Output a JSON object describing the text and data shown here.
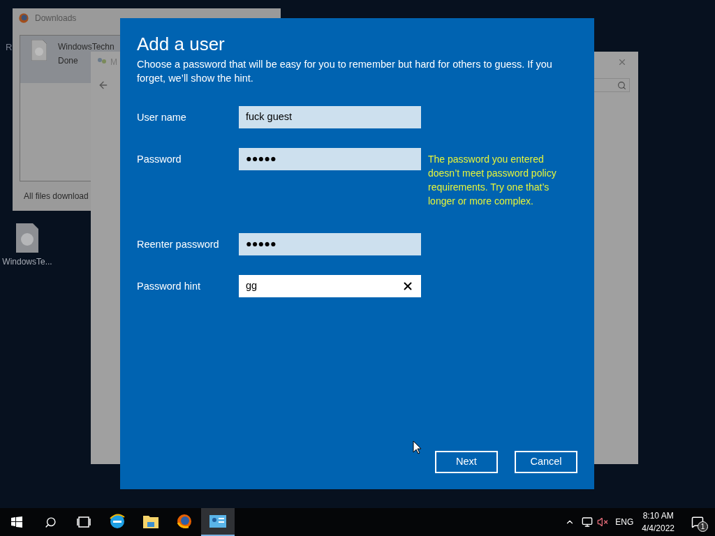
{
  "desktop": {
    "edge_label": "R",
    "icons": [
      {
        "label": "WindowsTe..."
      }
    ]
  },
  "downloads_window": {
    "title": "Downloads",
    "items": [
      {
        "name": "WindowsTechn",
        "status": "Done",
        "selected": true
      }
    ],
    "footer": "All files download"
  },
  "back_window": {
    "title": "M"
  },
  "dialog": {
    "title": "Add a user",
    "description": "Choose a password that will be easy for you to remember but hard for others to guess. If you forget, we’ll show the hint.",
    "fields": [
      {
        "label": "User name",
        "value": "fuck guest",
        "focused": false
      },
      {
        "label": "Password",
        "value": "●●●●●",
        "focused": false,
        "error": "The password you entered doesn’t meet password policy requirements. Try one that’s longer or more complex."
      },
      {
        "label": "Reenter password",
        "value": "●●●●●",
        "focused": false
      },
      {
        "label": "Password hint",
        "value": "gg",
        "focused": true
      }
    ],
    "buttons": [
      "Next",
      "Cancel"
    ]
  },
  "taskbar": {
    "apps": [
      {
        "kind": "browser-e",
        "active": false
      },
      {
        "kind": "folder",
        "active": false
      },
      {
        "kind": "browser-fox",
        "active": false
      },
      {
        "kind": "users",
        "active": true
      }
    ],
    "language": "ENG",
    "time": "8:10 AM",
    "date": "4/4/2022",
    "notifications": "1"
  }
}
